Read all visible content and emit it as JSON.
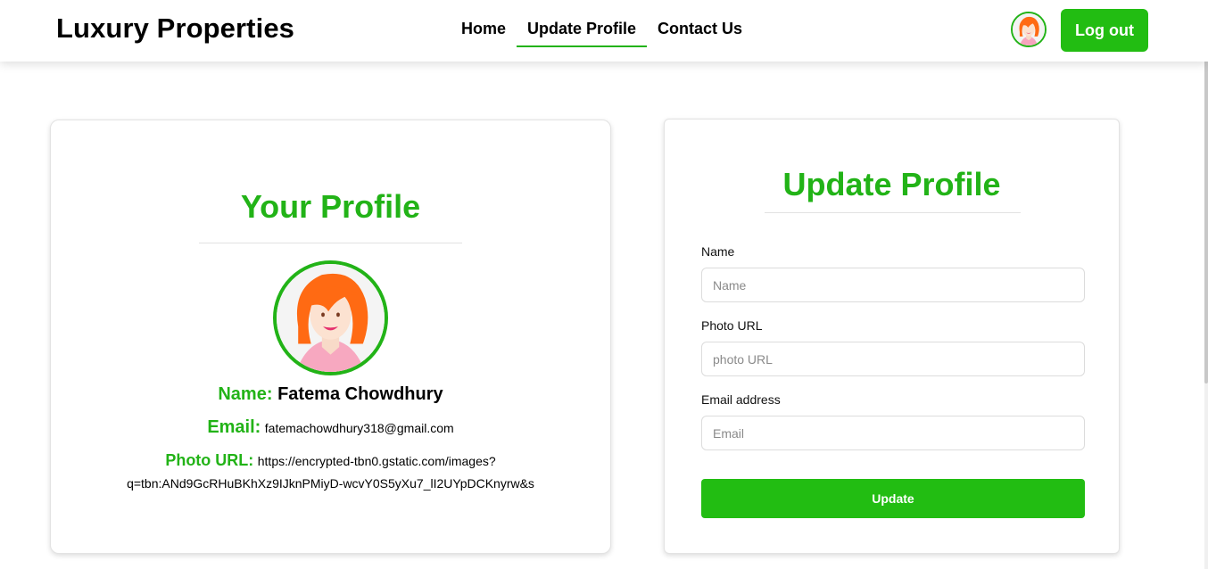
{
  "header": {
    "brand": "Luxury Properties",
    "nav": [
      "Home",
      "Update Profile",
      "Contact Us"
    ],
    "active_nav": "Update Profile",
    "logout_label": "Log out"
  },
  "profile": {
    "title": "Your Profile",
    "name_label": "Name:",
    "name_value": "Fatema Chowdhury",
    "email_label": "Email:",
    "email_value": "fatemachowdhury318@gmail.com",
    "photo_label": "Photo URL:",
    "photo_value_line1": "https://encrypted-tbn0.gstatic.com/images?",
    "photo_value_line2": "q=tbn:ANd9GcRHuBKhXz9IJknPMiyD-wcvY0S5yXu7_lI2UYpDCKnyrw&s"
  },
  "form": {
    "title": "Update Profile",
    "name_label": "Name",
    "name_placeholder": "Name",
    "photo_label": "Photo URL",
    "photo_placeholder": "photo URL",
    "email_label": "Email address",
    "email_placeholder": "Email",
    "submit_label": "Update"
  },
  "colors": {
    "accent": "#22b317",
    "button": "#22bd12"
  },
  "icons": {
    "avatar": "female-avatar-icon"
  }
}
